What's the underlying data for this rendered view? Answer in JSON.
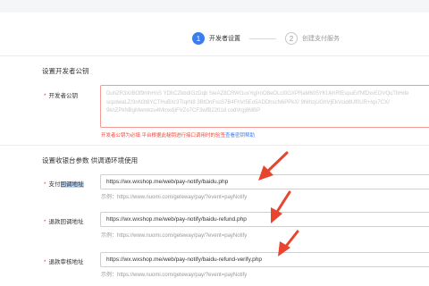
{
  "steps": [
    {
      "number": "1",
      "label": "开发者设置"
    },
    {
      "number": "2",
      "label": "创建支付服务"
    }
  ],
  "developer_key_section": {
    "title": "设置开发者公钥",
    "field_label": "开发者公钥",
    "key_lines": [
      "DuhZR3XrBOf9mhHnS YDhCZkbdIGzDqb SieAZ8CRWGuxYqjIrnO8eOLcI0GXPRaM605YKUkhRfEspuErfNfDxvEDVQuTbHde",
      "scpdwaLZ/3nN3t8YCTHuBXr3TIqrN8 3BtOnFssS7B4FhVr5Eo5ADDhscN6PPkX/ 9NihzjUGhVjEkVcid8Uf0UR+/qx7CX/",
      "9knZPkNBgMwmkzu4MmxdjiFVZo7CF3wfB2201d codVrgj8MBP"
    ],
    "error_prefix": "开发者公钥为必填 平台根据此秘钥进行接口调用时的验签",
    "error_link": "查看密钥帮助"
  },
  "callback_section": {
    "title_prefix": "设置收银台参数 供调通环境使用",
    "fields": [
      {
        "label_prefix": "支付",
        "label_highlight": "回调地址",
        "value": "https://wx.wxshop.me/web/pay-notify/baidu.php",
        "example": "示例：https://www.nuomi.com/geteway/pay/?event=payNotify"
      },
      {
        "label_prefix": "退款回调地址",
        "label_highlight": "",
        "value": "https://wx.wxshop.me/web/pay-notify/baidu-refund.php",
        "example": "示例：https://www.nuomi.com/geteway/pay/?event=payNotify"
      },
      {
        "label_prefix": "退款审核地址",
        "label_highlight": "",
        "value": "https://wx.wxshop.me/web/pay-notify/baidu-refund-verify.php",
        "example": "示例：https://www.nuomi.com/geteway/pay/?event=payNotify"
      }
    ]
  },
  "colors": {
    "primary": "#3a7df0",
    "error": "#e64a3b",
    "annotation_arrow": "#e8452f"
  }
}
